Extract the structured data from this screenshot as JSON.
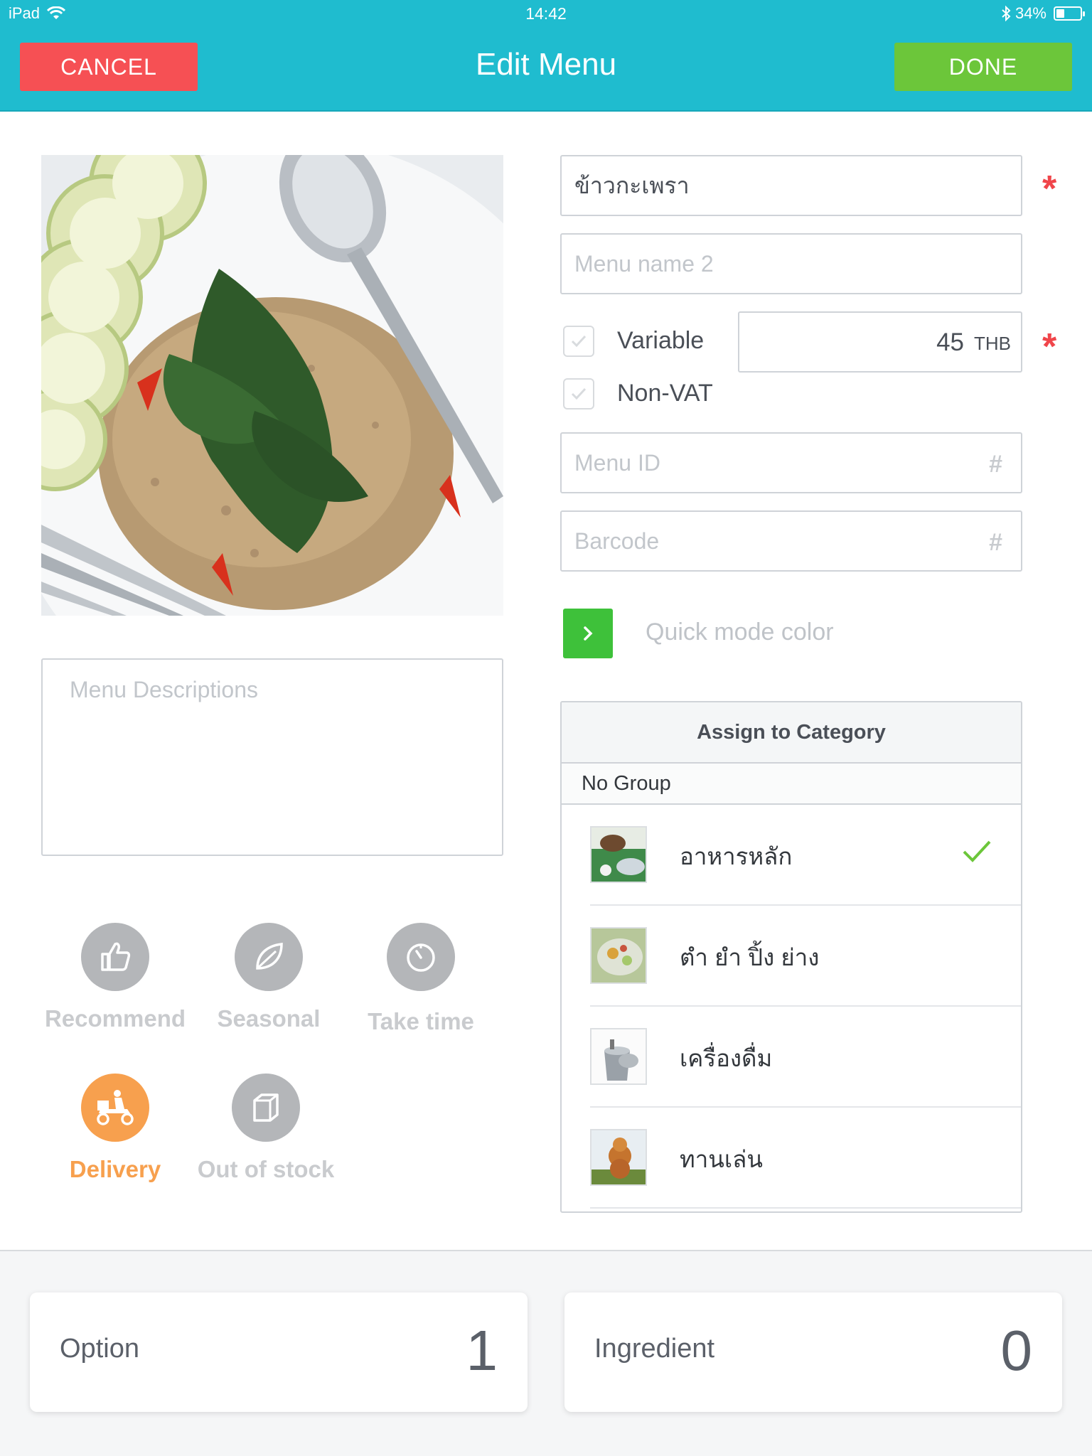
{
  "status_bar": {
    "device": "iPad",
    "time": "14:42",
    "battery_percent": "34%",
    "battery_level": 0.34
  },
  "header": {
    "cancel_label": "CANCEL",
    "title": "Edit Menu",
    "done_label": "DONE"
  },
  "form": {
    "menu_name_value": "ข้าวกะเพรา",
    "menu_name2_placeholder": "Menu name 2",
    "required_mark": "*",
    "variable_label": "Variable",
    "non_vat_label": "Non-VAT",
    "price_value": "45",
    "currency": "THB",
    "menu_id_placeholder": "Menu ID",
    "barcode_placeholder": "Barcode",
    "hash_symbol": "#",
    "quick_mode_label": "Quick mode color",
    "description_placeholder": "Menu Descriptions"
  },
  "tags": [
    {
      "label": "Recommend",
      "icon": "thumbs-up-icon",
      "active": false
    },
    {
      "label": "Seasonal",
      "icon": "leaf-icon",
      "active": false
    },
    {
      "label": "Take time",
      "icon": "timer-icon",
      "active": false
    },
    {
      "label": "Delivery",
      "icon": "delivery-scooter-icon",
      "active": true
    },
    {
      "label": "Out of stock",
      "icon": "box-icon",
      "active": false
    }
  ],
  "category": {
    "title": "Assign to Category",
    "group": "No Group",
    "items": [
      {
        "name": "อาหารหลัก",
        "selected": true
      },
      {
        "name": "ตำ ยำ ปิ้ง ย่าง",
        "selected": false
      },
      {
        "name": "เครื่องดื่ม",
        "selected": false
      },
      {
        "name": "ทานเล่น",
        "selected": false
      }
    ]
  },
  "bottom": {
    "option_label": "Option",
    "option_count": "1",
    "ingredient_label": "Ingredient",
    "ingredient_count": "0"
  },
  "colors": {
    "header": "#1fbccf",
    "cancel": "#f65054",
    "done": "#6cc63a",
    "delivery_active": "#f7a04e",
    "quick_mode": "#3ec13a",
    "required": "#f0454a"
  }
}
